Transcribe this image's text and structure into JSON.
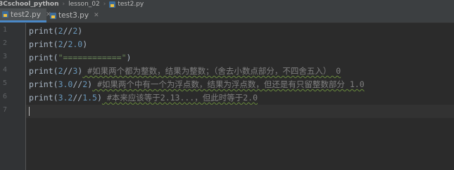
{
  "breadcrumb": {
    "project": "3Cschool_python",
    "folder": "lesson_02",
    "file": "test2.py"
  },
  "tabs": [
    {
      "label": "test2.py",
      "close": "✕",
      "active": true
    },
    {
      "label": "test3.py",
      "close": "✕",
      "active": false
    }
  ],
  "line_numbers": [
    "1",
    "2",
    "3",
    "4",
    "5",
    "6",
    "7"
  ],
  "code": {
    "line1": {
      "fn": "print",
      "open": "(",
      "a": "2",
      "op": "//",
      "b": "2",
      "close": ")"
    },
    "line2": {
      "fn": "print",
      "open": "(",
      "a": "2",
      "op": "/",
      "b": "2.0",
      "close": ")"
    },
    "line3": {
      "fn": "print",
      "open": "(",
      "s": "\"============\"",
      "close": ")"
    },
    "line4": {
      "fn": "print",
      "open": "(",
      "a": "2",
      "op": "//",
      "b": "3",
      "close": ")",
      "comment": " #如果两个都为整数，结果为整数；（舍去小数点部分，不四舍五入） 0"
    },
    "line5": {
      "fn": "print",
      "open": "(",
      "a": "3.0",
      "op": "//",
      "b": "2",
      "close": ")",
      "comment": " #如果两个中有一个为浮点数，结果为浮点数，但还是有只留整数部分 1.0"
    },
    "line6": {
      "fn": "print",
      "open": "(",
      "a": "3.2",
      "op": "//",
      "b": "1.5",
      "close": ")",
      "comment": " #本来应该等于2.13...，但此时等于2.0"
    },
    "line7": {}
  },
  "colors": {
    "background": "#2b2b2b",
    "text": "#a9b7c6",
    "number": "#6897bb",
    "string": "#6a8759",
    "comment": "#808080",
    "active_tab_underline": "#4a88c7"
  },
  "icons": {
    "file_icon": "python-file-icon"
  }
}
